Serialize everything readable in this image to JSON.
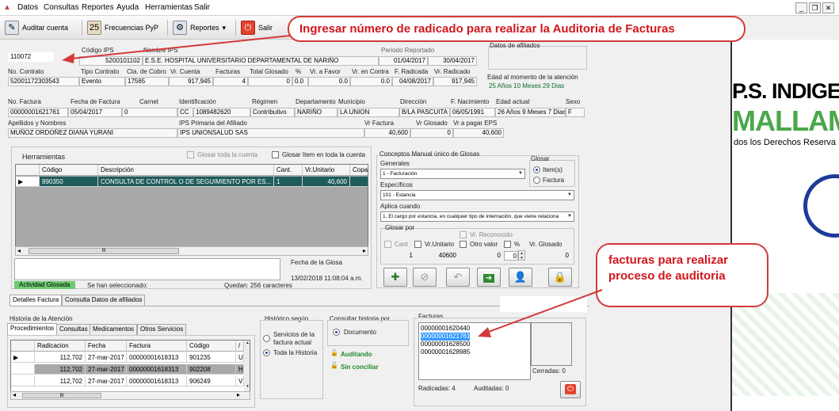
{
  "menu": {
    "items": [
      "Datos",
      "Consultas",
      "Reportes",
      "Ayuda",
      "Herramientas",
      "Salir"
    ]
  },
  "toolbar": {
    "auditar": "Auditar cuenta",
    "frecuencias": "Frecuencias PyP",
    "reportes": "Reportes",
    "salir": "Salir"
  },
  "header": {
    "radicado_value": "110072",
    "codigo_ips_label": "Código IPS",
    "nombre_ips_label": "Nombre IPS",
    "periodo_label": "Periodo Reportado",
    "datos_afiliados_label": "Datos de afiliados",
    "codigo_ips": "5200101102",
    "nombre_ips": "E.S.E. HOSPITAL UNIVERSITARIO DEPARTAMENTAL DE NARIÑO",
    "periodo_desde": "01/04/2017",
    "periodo_hasta": "30/04/2017",
    "labels": [
      "No. Contrato",
      "Tipo Contrato",
      "Cta. de Cobro",
      "Vr. Cuenta",
      "Facturas",
      "Total Glosado",
      "%",
      "Vr. a Favor",
      "Vr. en Contra",
      "F. Radicada",
      "Vr. Radicado"
    ],
    "contrato": "52001172303543",
    "tipo_contrato": "Evento",
    "cta_cobro": "17565",
    "vr_cuenta": "917,945",
    "facturas": "4",
    "total_glosado": "0",
    "porcentaje": "0.0",
    "vr_favor": "0.0",
    "vr_contra": "0.0",
    "f_radicada": "04/08/2017",
    "vr_radicado": "917,945",
    "edad_label": "Edad al momento de la atención",
    "edad_value": "25 Años 10 Meses 29 Dias"
  },
  "factura": {
    "labels": [
      "No. Factura",
      "Fecha de Factura",
      "Carnet",
      "Identificación",
      "Régimen",
      "Departamento",
      "Municipio",
      "Dirección",
      "F. Nacimiento",
      "Edad actual",
      "Sexo"
    ],
    "no_factura": "00000001621761",
    "fecha": "05/04/2017",
    "carnet": "0",
    "id_tipo": "CC",
    "id_num": "1089482620",
    "regimen": "Contributivo",
    "departamento": "NARIÑO",
    "municipio": "LA UNION",
    "direccion": "B/LA PASCUITA",
    "f_nacimiento": "06/05/1991",
    "edad_actual": "26 Años 9 Meses 7 Dias",
    "sexo": "F",
    "apellidos_label": "Apellidos y Nombres",
    "ips_primaria_label": "IPS Primaria del Afiliado",
    "vr_factura_label": "Vr Factura",
    "vr_glosado_label": "Vr Glosado",
    "vr_pagar_label": "Vr a pagar EPS",
    "apellidos": "MUÑOZ ORDOÑEZ DIANA YURANI",
    "ips_primaria": "IPS UNIONSALUD SAS",
    "vr_factura": "40,600",
    "vr_glosado": "0",
    "vr_pagar": "40,600"
  },
  "herramientas": {
    "title": "Herramientas",
    "glosar_toda": "Glosar toda la cuenta",
    "glosar_item": "Glosar Item en toda la cuenta",
    "columns": [
      "Código",
      "Descripción",
      "Cant.",
      "Vr.Unitario",
      "Copa"
    ],
    "rows": [
      {
        "codigo": "890350",
        "descripcion": "CONSULTA DE CONTROL O DE SEGUIMIENTO POR ES...",
        "cant": "1",
        "vr": "40,600"
      }
    ],
    "scroll_glyph": "III",
    "fecha_glosa_label": "Fecha de la Glosa",
    "fecha_glosa": "13/02/2018 11:08:04 a.m.",
    "actividad": "Actividad Glosada",
    "seleccionado": "Se han seleccionado:",
    "quedan": "Quedan:  256 caracteres"
  },
  "conceptos": {
    "title": "Conceptos Manual único de Glosas",
    "generales_label": "Generales",
    "generales_value": "1 - Facturación",
    "especificos_label": "Específicos",
    "especificos_value": "101 - Estancia",
    "aplica_label": "Aplica cuando",
    "aplica_value": "1. El cargo por estancia, en cualquier tipo de internación, que viene relaciona",
    "glosar_label": "Glosar",
    "opt_item": "Item(s)",
    "opt_factura": "Factura",
    "glosar_por": "Glosar por",
    "vr_reconocido": "Vr. Reconocido",
    "cant": "Cant",
    "vr_unitario": "Vr.Unitario",
    "otro_valor": "Otro valor",
    "porcentaje": "%",
    "vr_glosado": "Vr. Glosado",
    "cant_value": "1",
    "vr_unitario_value": "40600",
    "otro_valor_value": "0",
    "pct_value": "0",
    "vr_glosado_value": "0"
  },
  "tabs_mid": [
    "Detalles Factura",
    "Consulta Datos de afiliados"
  ],
  "historia": {
    "title": "Historia de la Atención",
    "tabs": [
      "Procedimientos",
      "Consultas",
      "Medicamentos",
      "Otros Servicios"
    ],
    "columns": [
      "Radicacion",
      "Fecha",
      "Factura",
      "Código",
      "/"
    ],
    "rows": [
      {
        "radicacion": "112,702",
        "fecha": "27-mar-2017",
        "factura": "00000001618313",
        "codigo": "901235",
        "extra": "U"
      },
      {
        "radicacion": "112,702",
        "fecha": "27-mar-2017",
        "factura": "00000001618313",
        "codigo": "902208",
        "extra": "H"
      },
      {
        "radicacion": "112,702",
        "fecha": "27-mar-2017",
        "factura": "00000001618313",
        "codigo": "906249",
        "extra": "V"
      }
    ],
    "scroll_glyph": "III"
  },
  "historico": {
    "title": "Histórico según",
    "opt1": "Servicios de la factura actual",
    "opt2": "Toda la Historia"
  },
  "consultar": {
    "title": "Consultar historia por",
    "documento": "Documento",
    "auditando": "Auditando",
    "sin_conciliar": "Sin conciliar"
  },
  "facturas_panel": {
    "title": "Facturas",
    "items": [
      "00000001620440",
      "00000001621761",
      "00000001628500",
      "00000001628985"
    ],
    "selected_index": 1,
    "cerradas": "Cerradas: 0",
    "radicadas": "Radicadas: 4",
    "auditadas": "Auditadas: 0"
  },
  "banner": {
    "line1": "P.S. INDIGEN",
    "line2": "MALLAMA",
    "line3": "dos los Derechos Reserva"
  },
  "callouts": {
    "top": "Ingresar número de radicado para realizar la Auditoria de Facturas",
    "bottom": "facturas para realizar proceso de auditoria"
  },
  "colors": {
    "selection": "#1f5c5c",
    "accent_red": "#d0161c",
    "banner_green": "#4aa84a",
    "highlight": "#3399ff"
  }
}
